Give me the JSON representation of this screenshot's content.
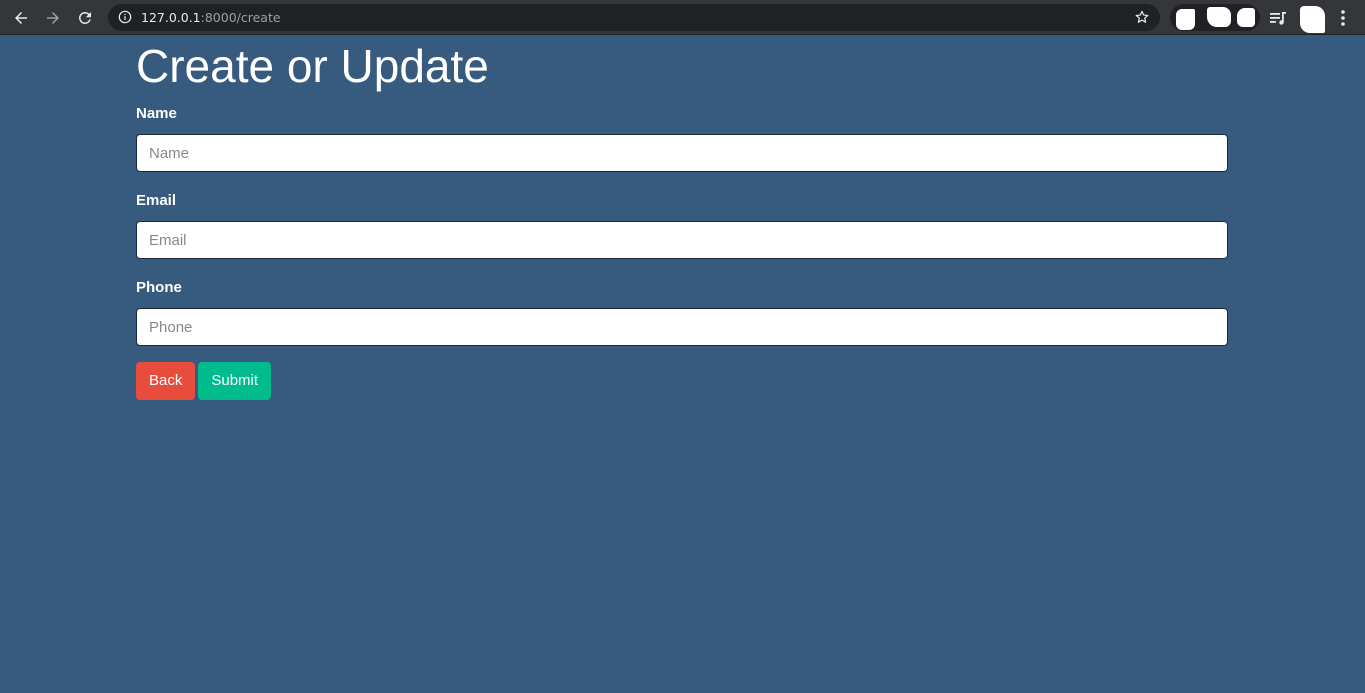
{
  "browser": {
    "url_host": "127.0.0.1",
    "url_path": ":8000/create"
  },
  "page": {
    "title": "Create or Update"
  },
  "form": {
    "name": {
      "label": "Name",
      "placeholder": "Name",
      "value": ""
    },
    "email": {
      "label": "Email",
      "placeholder": "Email",
      "value": ""
    },
    "phone": {
      "label": "Phone",
      "placeholder": "Phone",
      "value": ""
    }
  },
  "buttons": {
    "back_label": "Back",
    "submit_label": "Submit"
  },
  "colors": {
    "page_background": "#375a7f",
    "back_button": "#e74c3c",
    "submit_button": "#00bc8c"
  },
  "icons": [
    "back-arrow-icon",
    "forward-arrow-icon",
    "reload-icon",
    "info-icon",
    "star-icon",
    "media-control-icon",
    "kebab-menu-icon"
  ]
}
